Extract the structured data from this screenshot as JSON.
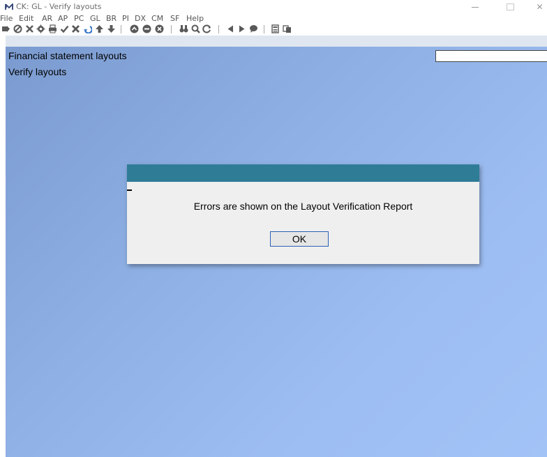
{
  "window": {
    "title": "CK: GL - Verify layouts",
    "minimize_glyph": "—",
    "close_glyph": "✕"
  },
  "menu": [
    "File",
    "Edit",
    "AR",
    "AP",
    "PC",
    "GL",
    "BR",
    "PI",
    "DX",
    "CM",
    "SF",
    "Help"
  ],
  "toolbar": {
    "icons": [
      "export-icon",
      "stop-icon",
      "tools-icon",
      "settings-icon",
      "print-icon",
      "check-icon",
      "cancel-icon",
      "undo-icon",
      "up-arrow-icon",
      "down-arrow-icon",
      "circle-up-icon",
      "circle-minus-icon",
      "circle-x-icon",
      "binoculars-icon",
      "magnify-icon",
      "refresh-icon",
      "prev-icon",
      "next-icon",
      "comment-icon",
      "calculator-icon",
      "copy-icon"
    ]
  },
  "main": {
    "heading": "Financial statement layouts",
    "subheading": "Verify layouts"
  },
  "dialog": {
    "message": "Errors are shown on the Layout Verification Report",
    "ok_label": "OK"
  },
  "colors": {
    "dialog_title": "#2e7c96",
    "dialog_body": "#efefef",
    "background_start": "#7b9bd0",
    "background_end": "#a2c3f6",
    "toolbar_icon": "#595959",
    "toolbar_icon_blue": "#3c78c8"
  }
}
